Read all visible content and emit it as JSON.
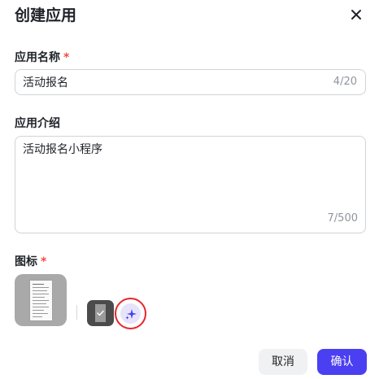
{
  "dialog": {
    "title": "创建应用",
    "close_icon": "close-icon"
  },
  "name_field": {
    "label": "应用名称",
    "required_mark": "*",
    "value": "活动报名",
    "count": "4/20"
  },
  "desc_field": {
    "label": "应用介绍",
    "value": "活动报名小程序",
    "count": "7/500"
  },
  "icon_field": {
    "label": "图标",
    "required_mark": "*",
    "preview_icon": "document-icon",
    "option_icon": "checklist-icon",
    "ai_icon": "sparkle-icon"
  },
  "footer": {
    "cancel_label": "取消",
    "confirm_label": "确认"
  },
  "colors": {
    "primary": "#4b3ff2",
    "required": "#f54a45",
    "highlight_ring": "#e8262b",
    "ai_button_bg": "#e6e4fb"
  }
}
